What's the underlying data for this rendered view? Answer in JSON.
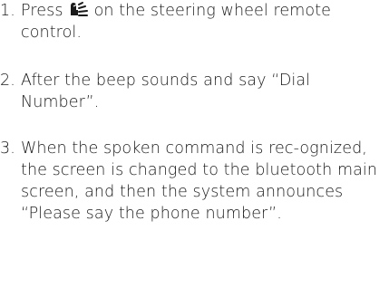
{
  "steps": [
    {
      "number": "1.",
      "text_before_icon": "Press",
      "icon": "voice-recognition-icon",
      "text_after_icon": "on the steering wheel remote control."
    },
    {
      "number": "2.",
      "text": "After the beep sounds and say “Dial Number”."
    },
    {
      "number": "3.",
      "text": "When the spoken command is rec-ognized, the screen is changed to the bluetooth main screen, and then the system announces “Please say the phone number”."
    }
  ]
}
